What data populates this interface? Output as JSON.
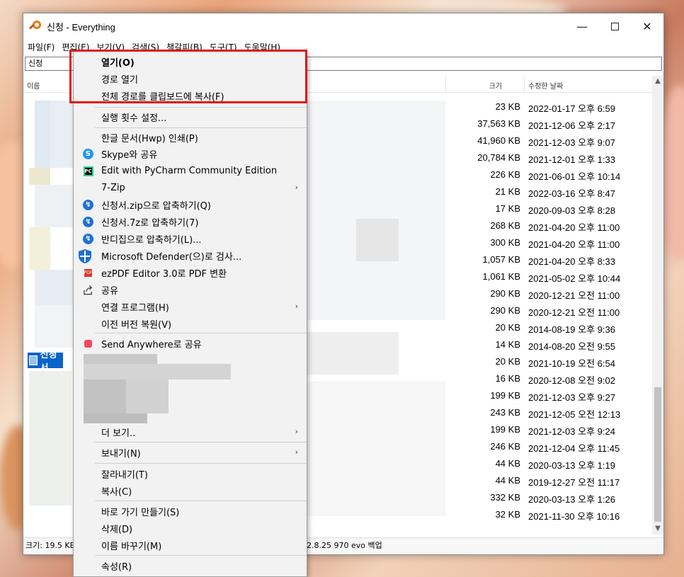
{
  "window": {
    "title": "신청 - Everything",
    "controls": {
      "minimize": "—",
      "maximize": "",
      "close": "✕"
    }
  },
  "menubar": [
    "파일(F)",
    "편집(E)",
    "보기(V)",
    "검색(S)",
    "책갈피(B)",
    "도구(T)",
    "도움말(H)"
  ],
  "search": {
    "value": "신청"
  },
  "columns": {
    "name": "이름",
    "size": "크기",
    "modified": "수정한 날짜"
  },
  "rows": [
    {
      "size": "23 KB",
      "date": "2022-01-17 오후 6:59"
    },
    {
      "size": "37,563 KB",
      "date": "2021-12-06 오후 2:17"
    },
    {
      "size": "41,960 KB",
      "date": "2021-12-03 오후 9:07"
    },
    {
      "size": "20,784 KB",
      "date": "2021-12-01 오후 1:33"
    },
    {
      "size": "226 KB",
      "date": "2021-06-01 오후 10:14"
    },
    {
      "size": "21 KB",
      "date": "2022-03-16 오후 8:47"
    },
    {
      "size": "17 KB",
      "date": "2020-09-03 오후 8:28"
    },
    {
      "size": "268 KB",
      "date": "2021-04-20 오후 11:00"
    },
    {
      "size": "300 KB",
      "date": "2021-04-20 오후 11:00"
    },
    {
      "size": "1,057 KB",
      "date": "2021-04-20 오후 8:33"
    },
    {
      "size": "1,061 KB",
      "date": "2021-05-02 오후 10:44"
    },
    {
      "size": "290 KB",
      "date": "2020-12-21 오전 11:00"
    },
    {
      "size": "290 KB",
      "date": "2020-12-21 오전 11:00"
    },
    {
      "size": "20 KB",
      "date": "2014-08-19 오후 9:36"
    },
    {
      "size": "14 KB",
      "date": "2014-08-20 오전 9:55"
    },
    {
      "size": "20 KB",
      "date": "2021-10-19 오전 6:54"
    },
    {
      "size": "16 KB",
      "date": "2020-12-08 오전 9:02"
    },
    {
      "size": "199 KB",
      "date": "2021-12-03 오후 9:27"
    },
    {
      "size": "243 KB",
      "date": "2021-12-05 오전 12:13"
    },
    {
      "size": "199 KB",
      "date": "2021-12-03 오후 9:24"
    },
    {
      "size": "246 KB",
      "date": "2021-12-04 오후 11:45"
    },
    {
      "size": "44 KB",
      "date": "2020-03-13 오후 1:19"
    },
    {
      "size": "44 KB",
      "date": "2019-12-27 오전 11:17"
    },
    {
      "size": "332 KB",
      "date": "2020-03-13 오후 1:26"
    },
    {
      "size": "32 KB",
      "date": "2021-11-30 오후 10:16"
    }
  ],
  "selected_item": {
    "label": "신청서."
  },
  "statusbar": {
    "left": "크기: 19.5 KB",
    "right": "2.8.25 970 evo 백업"
  },
  "context_menu": {
    "open": "열기(O)",
    "open_path": "경로 열기",
    "copy_full_path": "전체 경로를 클립보드에 복사(F)",
    "run_count": "실행 횟수 설정...",
    "hwp_print": "한글 문서(Hwp) 인쇄(P)",
    "skype_share": "Skype와 공유",
    "pycharm": "Edit with PyCharm Community Edition",
    "sevenzip": "7-Zip",
    "zip_compress": "신청서.zip으로 압축하기(Q)",
    "sevenz_compress": "신청서.7z로 압축하기(7)",
    "bandizip_compress": "반디집으로 압축하기(L)...",
    "defender": "Microsoft Defender(으)로 검사...",
    "ezpdf": "ezPDF Editor 3.0로 PDF 변환",
    "share": "공유",
    "open_with": "연결 프로그램(H)",
    "restore_versions": "이전 버전 복원(V)",
    "send_anywhere": "Send Anywhere로 공유",
    "more": "더 보기..",
    "send_to": "보내기(N)",
    "cut": "잘라내기(T)",
    "copy": "복사(C)",
    "create_shortcut": "바로 가기 만들기(S)",
    "delete": "삭제(D)",
    "rename": "이름 바꾸기(M)",
    "properties": "속성(R)"
  },
  "colors": {
    "highlight_border": "#e31414",
    "selection": "#0a64c8"
  }
}
